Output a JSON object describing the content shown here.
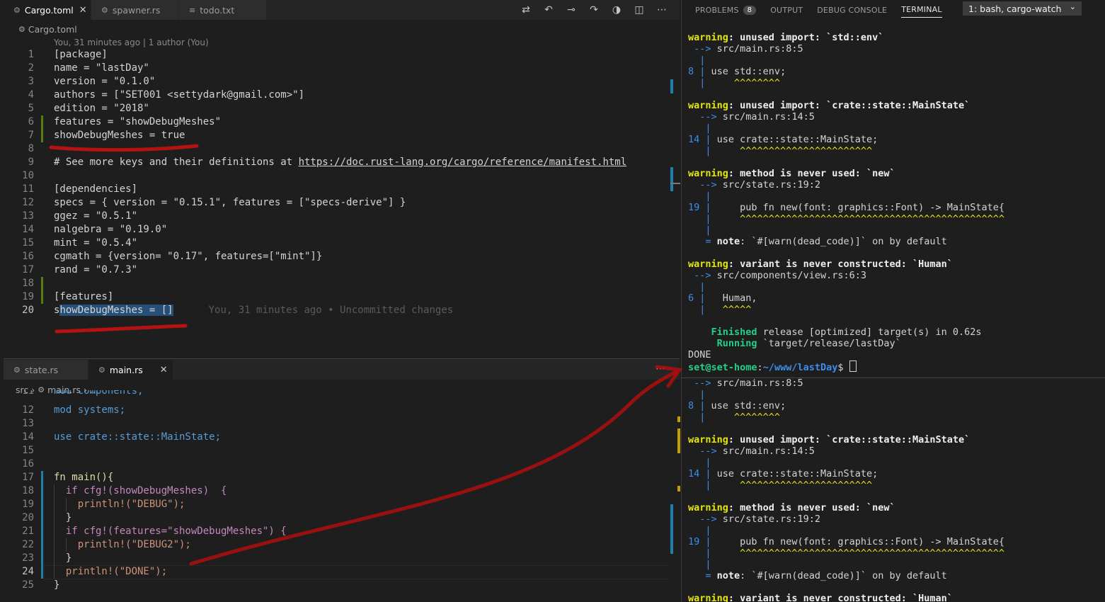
{
  "top_editor": {
    "tabs": [
      {
        "label": "Cargo.toml",
        "icon": "gear-icon",
        "active": true
      },
      {
        "label": "spawner.rs",
        "icon": "rust-icon",
        "active": false
      },
      {
        "label": "todo.txt",
        "icon": "lines-icon",
        "active": false
      }
    ],
    "breadcrumb": "Cargo.toml",
    "blame_header": "You, 31 minutes ago | 1 author (You)",
    "inline_blame": "You, 31 minutes ago • Uncommitted changes",
    "lines": [
      {
        "n": "1",
        "t": "[package]"
      },
      {
        "n": "2",
        "t": "name = \"lastDay\""
      },
      {
        "n": "3",
        "t": "version = \"0.1.0\""
      },
      {
        "n": "4",
        "t": "authors = [\"SET001 <settydark@gmail.com>\"]"
      },
      {
        "n": "5",
        "t": "edition = \"2018\""
      },
      {
        "n": "6",
        "t": "features = \"showDebugMeshes\""
      },
      {
        "n": "7",
        "t": "showDebugMeshes = true"
      },
      {
        "n": "8",
        "t": ""
      },
      {
        "n": "9",
        "t": "# See more keys and their definitions at ",
        "link": "https://doc.rust-lang.org/cargo/reference/manifest.html"
      },
      {
        "n": "10",
        "t": ""
      },
      {
        "n": "11",
        "t": "[dependencies]"
      },
      {
        "n": "12",
        "t": "specs = { version = \"0.15.1\", features = [\"specs-derive\"] }"
      },
      {
        "n": "13",
        "t": "ggez = \"0.5.1\""
      },
      {
        "n": "14",
        "t": "nalgebra = \"0.19.0\""
      },
      {
        "n": "15",
        "t": "mint = \"0.5.4\""
      },
      {
        "n": "16",
        "t": "cgmath = {version= \"0.17\", features=[\"mint\"]}"
      },
      {
        "n": "17",
        "t": "rand = \"0.7.3\""
      },
      {
        "n": "18",
        "t": ""
      },
      {
        "n": "19",
        "t": "[features]"
      },
      {
        "n": "20",
        "t": "s",
        "sel": "howDebugMeshes = []"
      }
    ]
  },
  "bottom_editor": {
    "tabs": [
      {
        "label": "state.rs",
        "icon": "rust-icon",
        "active": false
      },
      {
        "label": "main.rs",
        "icon": "rust-icon",
        "active": true
      }
    ],
    "breadcrumb": [
      "src",
      "main.rs",
      "..."
    ],
    "lines": [
      {
        "n": "11",
        "t": "mod components;"
      },
      {
        "n": "12",
        "t": "mod systems;"
      },
      {
        "n": "13",
        "t": ""
      },
      {
        "n": "14",
        "t": "use crate::state::MainState;"
      },
      {
        "n": "15",
        "t": ""
      },
      {
        "n": "16",
        "t": ""
      },
      {
        "n": "17",
        "t": "fn main(){"
      },
      {
        "n": "18",
        "t": "  if cfg!(showDebugMeshes)  {"
      },
      {
        "n": "19",
        "t": "    println!(\"DEBUG\");"
      },
      {
        "n": "20",
        "t": "  }"
      },
      {
        "n": "21",
        "t": "  if cfg!(features=\"showDebugMeshes\") {"
      },
      {
        "n": "22",
        "t": "    println!(\"DEBUG2\");"
      },
      {
        "n": "23",
        "t": "  }"
      },
      {
        "n": "24",
        "t": "  println!(\"DONE\");"
      },
      {
        "n": "25",
        "t": "}"
      }
    ]
  },
  "panel": {
    "tabs": [
      "PROBLEMS",
      "OUTPUT",
      "DEBUG CONSOLE",
      "TERMINAL"
    ],
    "problems_count": "8",
    "active_tab": "TERMINAL",
    "terminal_select": "1: bash, cargo-watch"
  },
  "terminal_top": {
    "w1_title": "unused import: `std::env`",
    "w1_loc": "src/main.rs:8:5",
    "w1_ln": "8",
    "w1_code": "use std::env;",
    "w1_sq": "^^^^^^^^",
    "w2_title": "unused import: `crate::state::MainState`",
    "w2_loc": "src/main.rs:14:5",
    "w2_ln": "14",
    "w2_code": "use crate::state::MainState;",
    "w2_sq": "^^^^^^^^^^^^^^^^^^^^^^^",
    "w3_title": "method is never used: `new`",
    "w3_loc": "src/state.rs:19:2",
    "w3_ln": "19",
    "w3_code": "pub fn new(font: graphics::Font) -> MainState{",
    "w3_sq": "^^^^^^^^^^^^^^^^^^^^^^^^^^^^^^^^^^^^^^^^^^^^^^",
    "note_label": "note",
    "note_text": ": `#[warn(dead_code)]` on by default",
    "w4_title": "variant is never constructed: `Human`",
    "w4_loc": "src/components/view.rs:6:3",
    "w4_ln": "6",
    "w4_code": "Human,",
    "w4_sq": "^^^^^",
    "finished_label": "Finished",
    "finished_text": " release [optimized] target(s) in 0.62s",
    "running_label": "Running",
    "running_text": " `target/release/lastDay`",
    "done": "DONE",
    "prompt_user": "set@set-home",
    "prompt_path": "~/www/lastDay",
    "prompt_symbol": "$ ",
    "warning_label": "warning",
    "arrow": "-->"
  }
}
